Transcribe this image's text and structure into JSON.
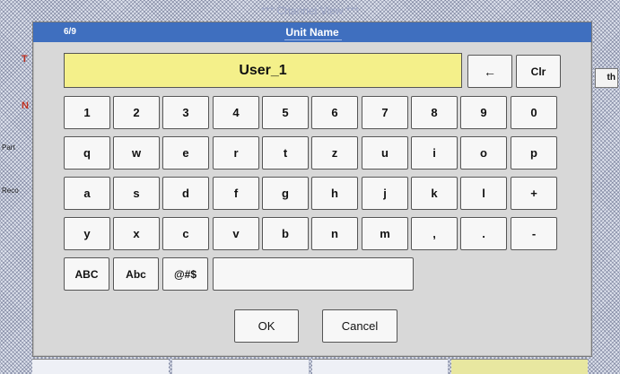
{
  "background": {
    "title": "***  Channel View  ***",
    "side_letters": [
      "T",
      "N"
    ],
    "left_labels": [
      "Part",
      "Reco"
    ],
    "right_button_label": "th"
  },
  "dialog": {
    "page_indicator": "6/9",
    "title": "Unit Name",
    "input_value": "User_1",
    "backspace_label": "←",
    "clear_label": "Clr",
    "rows": [
      [
        "1",
        "2",
        "3",
        "4",
        "5",
        "6",
        "7",
        "8",
        "9",
        "0"
      ],
      [
        "q",
        "w",
        "e",
        "r",
        "t",
        "z",
        "u",
        "i",
        "o",
        "p"
      ],
      [
        "a",
        "s",
        "d",
        "f",
        "g",
        "h",
        "j",
        "k",
        "l",
        "+"
      ],
      [
        "y",
        "x",
        "c",
        "v",
        "b",
        "n",
        "m",
        ",",
        ".",
        "-"
      ]
    ],
    "mode_keys": [
      "ABC",
      "Abc",
      "@#$"
    ],
    "ok_label": "OK",
    "cancel_label": "Cancel"
  },
  "colors": {
    "titlebar": "#3f6fbf",
    "display": "#f4f08a",
    "dialog": "#d8d8d8"
  }
}
